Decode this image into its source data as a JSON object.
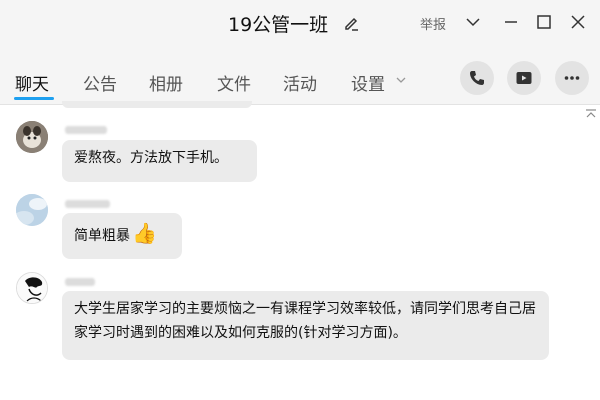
{
  "window": {
    "title": "19公管一班",
    "report_label": "举报"
  },
  "tabs": [
    {
      "label": "聊天",
      "active": true
    },
    {
      "label": "公告",
      "active": false
    },
    {
      "label": "相册",
      "active": false
    },
    {
      "label": "文件",
      "active": false
    },
    {
      "label": "活动",
      "active": false
    },
    {
      "label": "设置",
      "active": false
    }
  ],
  "toolbar_icons": [
    "phone-icon",
    "video-icon",
    "more-icon"
  ],
  "messages": [
    {
      "text": "爱熬夜。方法放下手机。"
    },
    {
      "text": "简单粗暴",
      "emoji": "👍"
    },
    {
      "text": "大学生居家学习的主要烦恼之一有课程学习效率较低，请同学们思考自己居家学习时遇到的困难以及如何克服的(针对学习方面)。"
    }
  ],
  "colors": {
    "accent": "#1ea0f0",
    "bubble": "#ebebeb",
    "chrome": "#f5f5f5"
  }
}
